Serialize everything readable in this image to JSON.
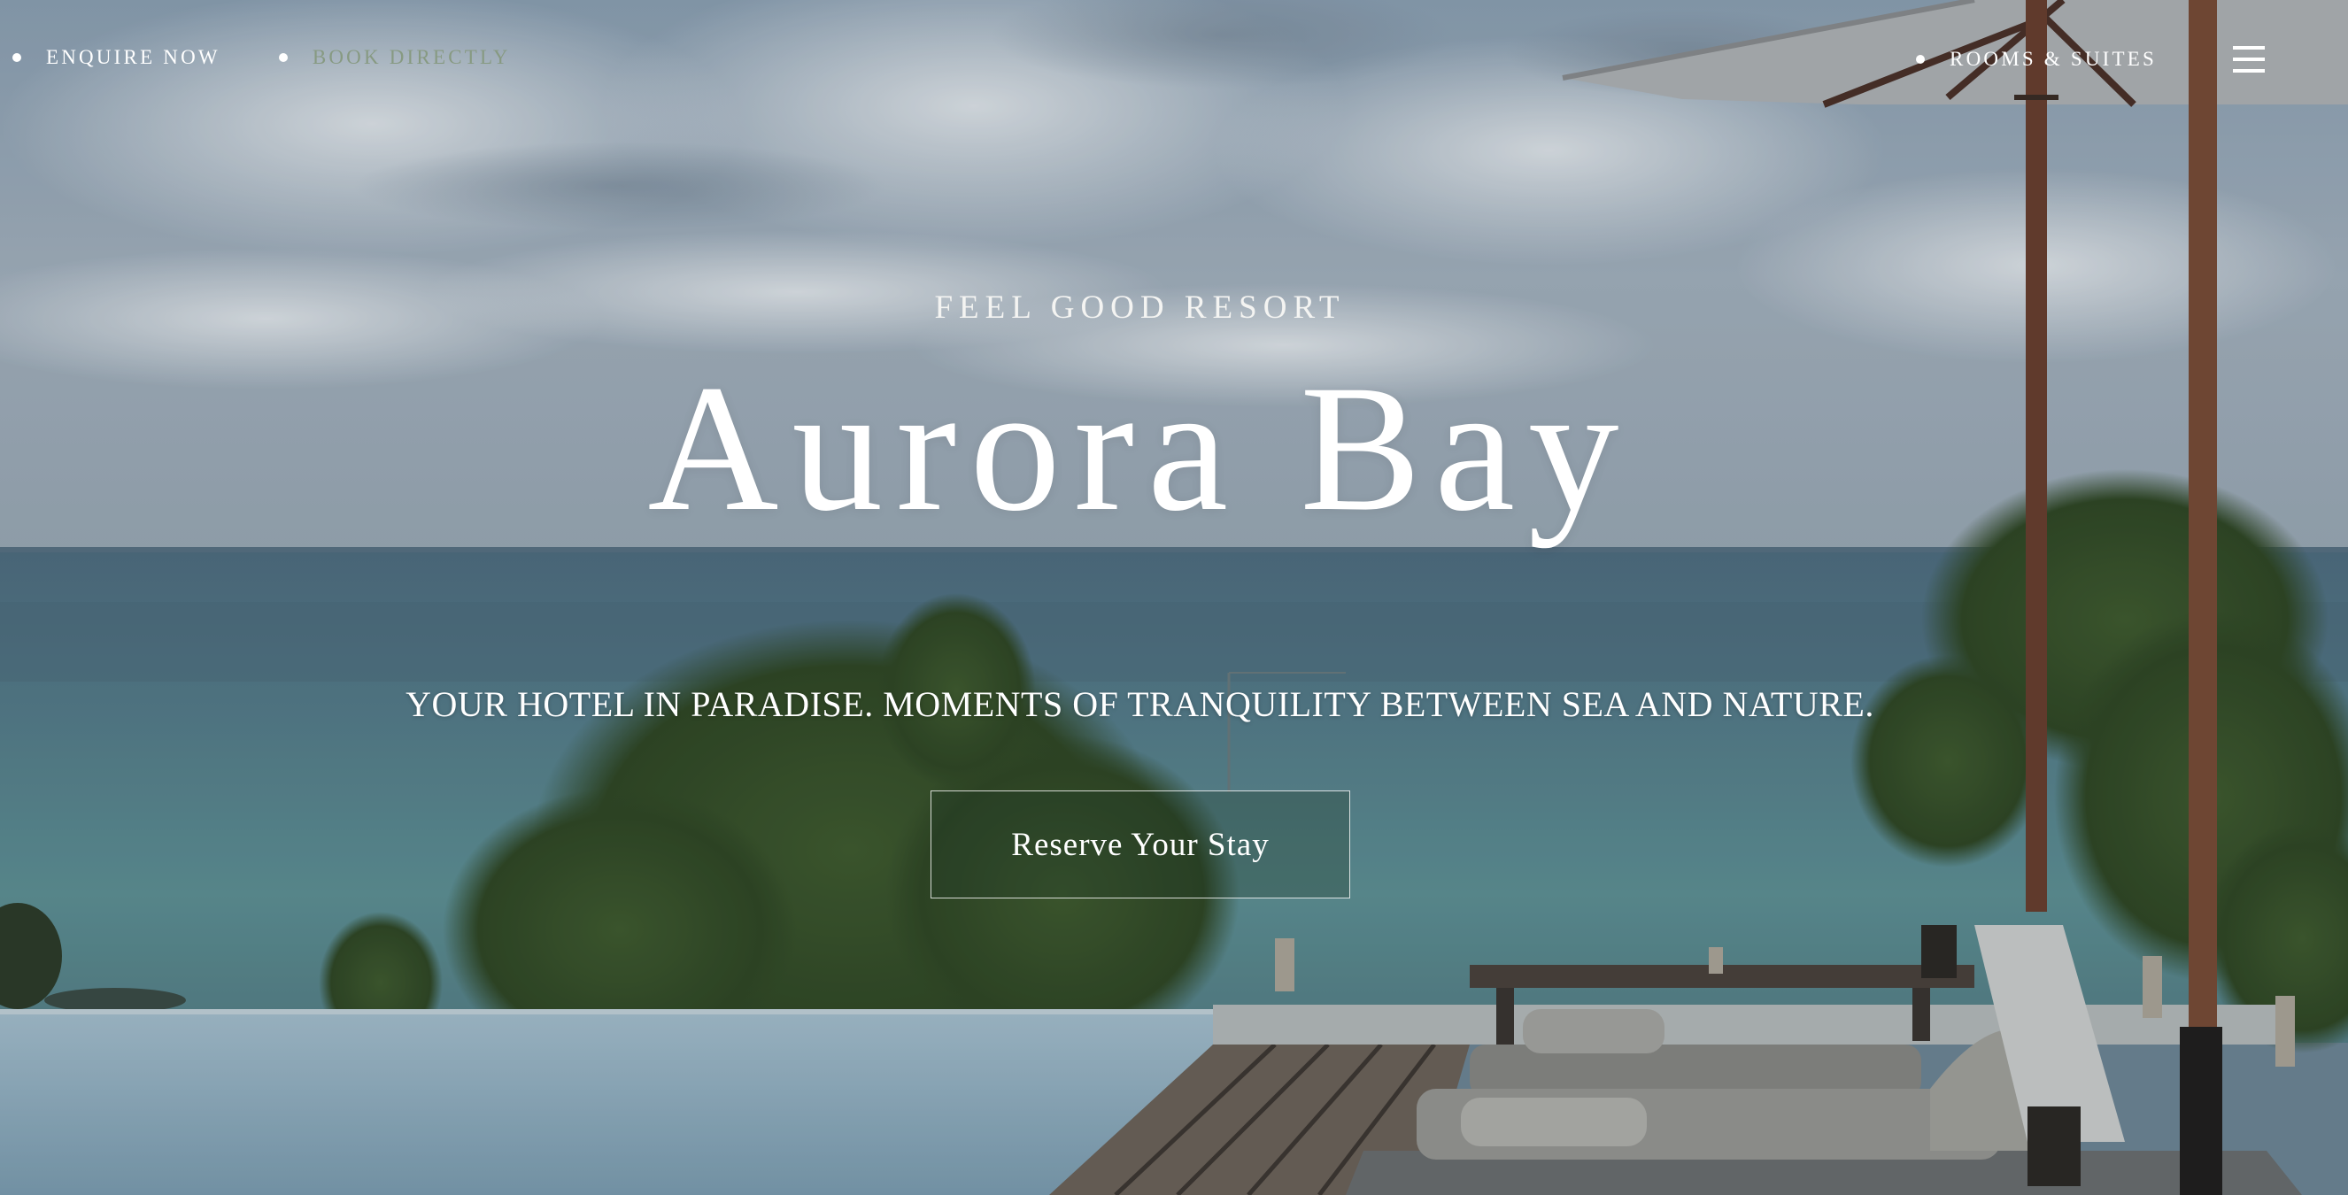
{
  "nav": {
    "enquire_label": "ENQUIRE NOW",
    "book_label": "BOOK DIRECTLY",
    "rooms_label": "ROOMS & SUITES",
    "menu_icon": "hamburger-menu-icon"
  },
  "hero": {
    "eyebrow": "FEEL GOOD RESORT",
    "title": "Aurora Bay",
    "tagline": "YOUR HOTEL IN PARADISE. MOMENTS OF TRANQUILITY BETWEEN SEA AND NATURE.",
    "cta_label": "Reserve Your Stay"
  },
  "colors": {
    "text": "#ffffff",
    "book_link": "#879a82",
    "sky": "#9fb0bf",
    "sea": "#5f8c94"
  }
}
